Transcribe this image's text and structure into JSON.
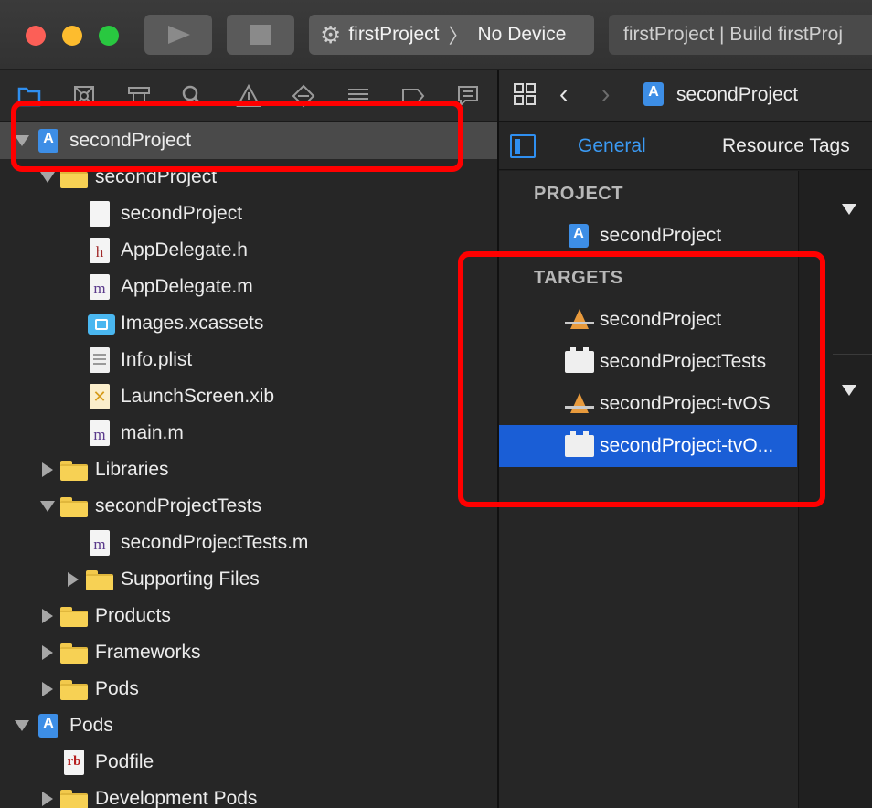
{
  "toolbar": {
    "scheme_project": "firstProject",
    "scheme_device": "No Device",
    "activity_text": "firstProject | Build firstProj"
  },
  "navigator": {
    "items": [
      {
        "label": "secondProject",
        "icon": "project-icon",
        "disclosure": "down",
        "selected": true
      },
      {
        "label": "secondProject",
        "icon": "folder-icon",
        "disclosure": "down"
      },
      {
        "label": "secondProject",
        "icon": "blank-file-icon"
      },
      {
        "label": "AppDelegate.h",
        "icon": "header-file-icon",
        "letter": "h"
      },
      {
        "label": "AppDelegate.m",
        "icon": "objc-file-icon",
        "letter": "m"
      },
      {
        "label": "Images.xcassets",
        "icon": "asset-catalog-icon"
      },
      {
        "label": "Info.plist",
        "icon": "plist-file-icon"
      },
      {
        "label": "LaunchScreen.xib",
        "icon": "xib-file-icon"
      },
      {
        "label": "main.m",
        "icon": "objc-file-icon",
        "letter": "m"
      },
      {
        "label": "Libraries",
        "icon": "folder-icon",
        "disclosure": "right"
      },
      {
        "label": "secondProjectTests",
        "icon": "folder-icon",
        "disclosure": "down"
      },
      {
        "label": "secondProjectTests.m",
        "icon": "objc-file-icon",
        "letter": "m"
      },
      {
        "label": "Supporting Files",
        "icon": "folder-icon",
        "disclosure": "right"
      },
      {
        "label": "Products",
        "icon": "folder-icon",
        "disclosure": "right"
      },
      {
        "label": "Frameworks",
        "icon": "folder-icon",
        "disclosure": "right"
      },
      {
        "label": "Pods",
        "icon": "folder-icon",
        "disclosure": "right"
      },
      {
        "label": "Pods",
        "icon": "project-icon",
        "disclosure": "down"
      },
      {
        "label": "Podfile",
        "icon": "ruby-file-icon",
        "letter": "rb"
      },
      {
        "label": "Development Pods",
        "icon": "folder-icon",
        "disclosure": "right"
      }
    ]
  },
  "editor": {
    "jump_title": "secondProject",
    "tabs": {
      "general": "General",
      "resource_tags": "Resource Tags"
    },
    "project_header": "PROJECT",
    "project_item": "secondProject",
    "targets_header": "TARGETS",
    "targets": [
      {
        "label": "secondProject",
        "icon": "app-target-icon"
      },
      {
        "label": "secondProjectTests",
        "icon": "bundle-target-icon"
      },
      {
        "label": "secondProject-tvOS",
        "icon": "app-target-icon"
      },
      {
        "label": "secondProject-tvO...",
        "icon": "bundle-target-icon",
        "selected": true
      }
    ]
  },
  "colors": {
    "accent": "#2f8ff0",
    "selection": "#1a5ed6",
    "annotation": "#ff0000"
  }
}
